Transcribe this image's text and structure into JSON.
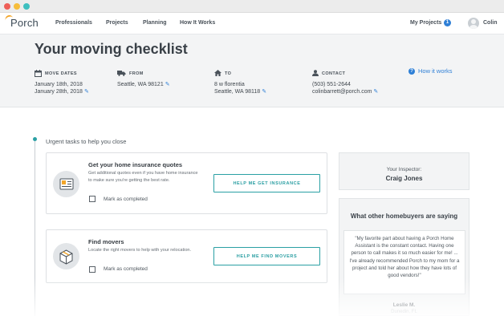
{
  "nav": {
    "brand": "Porch",
    "items": [
      {
        "label": "Professionals"
      },
      {
        "label": "Projects"
      },
      {
        "label": "Planning"
      },
      {
        "label": "How It Works"
      }
    ],
    "my_projects": "My Projects",
    "my_projects_count": "1",
    "user_name": "Colin"
  },
  "hero": {
    "title": "Your moving checklist",
    "move_dates": {
      "label": "MOVE DATES",
      "line1": "January 18th, 2018",
      "line2": "January 28th, 2018"
    },
    "from": {
      "label": "FROM",
      "line1": "Seattle, WA 98121"
    },
    "to": {
      "label": "TO",
      "line1": "8 w florentia",
      "line2": "Seattle, WA 98118"
    },
    "contact": {
      "label": "CONTACT",
      "line1": "(503) 551-2644",
      "line2": "colinbarrett@porch.com"
    },
    "how_it_works": "How it works"
  },
  "checklist": {
    "section_title": "Urgent tasks to help you close",
    "tasks": [
      {
        "title": "Get your home insurance quotes",
        "description": "Get additional quotes even if you have home insurance to make sure you're getting the best rate.",
        "checkbox_label": "Mark as completed",
        "button": "HELP ME GET INSURANCE",
        "completed": false
      },
      {
        "title": "Find movers",
        "description": "Locate the right movers to help with your relocation.",
        "checkbox_label": "Mark as completed",
        "button": "HELP ME FIND MOVERS",
        "completed": false
      }
    ]
  },
  "inspector": {
    "label": "Your Inspector:",
    "name": "Craig Jones"
  },
  "testimonial": {
    "title": "What other homebuyers are saying",
    "quote": "\"My favorite part about having a Porch Home Assistant is the constant contact. Having one person to call makes it so much easier for me! ... I've already recommended Porch to my mom for a project and told her about how they have lots of good vendors!\"",
    "author": "Leslie M.",
    "location": "Dunedin, FL"
  },
  "colors": {
    "accent": "#2aa0a4",
    "link": "#2e7fd6",
    "brand_arc": "#f3a629"
  }
}
